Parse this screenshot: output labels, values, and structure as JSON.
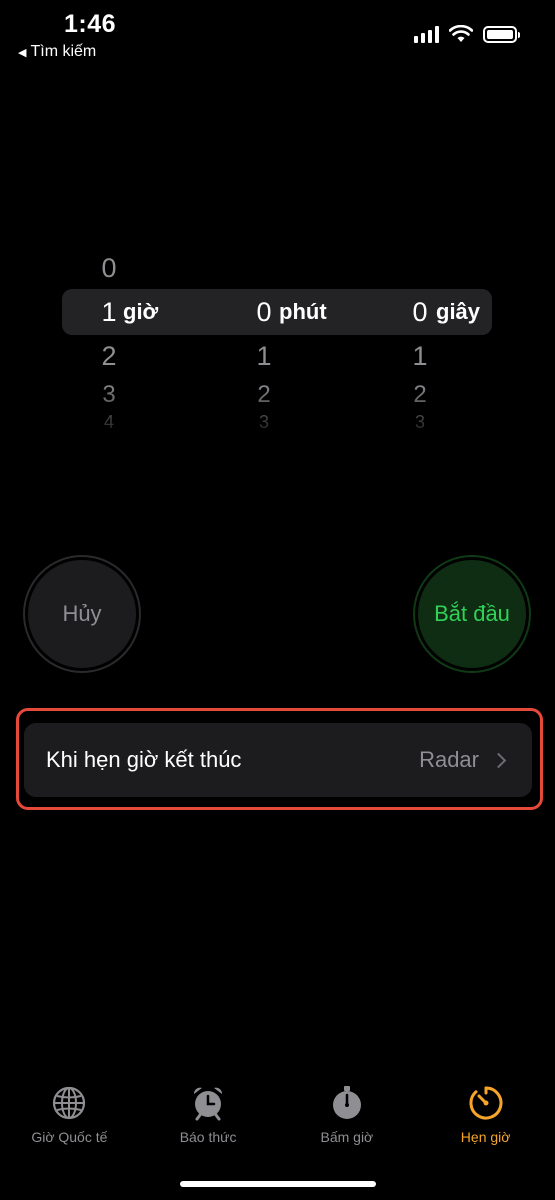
{
  "status": {
    "time": "1:46",
    "back_label": "Tìm kiếm",
    "icons": [
      "signal-icon",
      "wifi-icon",
      "battery-icon"
    ]
  },
  "picker": {
    "hours": {
      "above": "0",
      "selected": "1",
      "below": [
        "2",
        "3",
        "4"
      ],
      "unit": "giờ"
    },
    "minutes": {
      "selected": "0",
      "below": [
        "1",
        "2",
        "3"
      ],
      "unit": "phút"
    },
    "seconds": {
      "selected": "0",
      "below": [
        "1",
        "2",
        "3"
      ],
      "unit": "giây"
    }
  },
  "buttons": {
    "cancel_label": "Hủy",
    "start_label": "Bắt đầu"
  },
  "ending": {
    "label": "Khi hẹn giờ kết thúc",
    "value": "Radar"
  },
  "tabs": [
    {
      "label": "Giờ Quốc tế",
      "icon": "globe-icon",
      "active": false
    },
    {
      "label": "Báo thức",
      "icon": "alarm-clock-icon",
      "active": false
    },
    {
      "label": "Bấm giờ",
      "icon": "stopwatch-icon",
      "active": false
    },
    {
      "label": "Hẹn giờ",
      "icon": "timer-icon",
      "active": true
    }
  ],
  "colors": {
    "accent": "#f7a52a",
    "start_green": "#31d158",
    "highlight_red": "#e5493a"
  }
}
